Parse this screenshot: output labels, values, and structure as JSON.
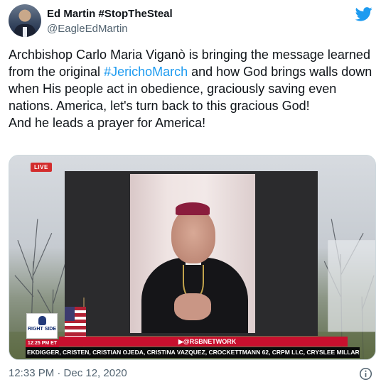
{
  "author": {
    "name": "Ed Martin #StopTheSteal",
    "handle": "@EagleEdMartin",
    "avatar_icon": "avatar-photo"
  },
  "tweet": {
    "text_before_link": "Archbishop Carlo Maria Viganò is bringing the message learned from the original ",
    "hashtag": "#JerichoMarch",
    "text_after_link": " and how God brings walls down when His people act in obedience, graciously saving even nations.  America, let's turn back to this gracious God!",
    "text_line_last": "And he leads a prayer for America!"
  },
  "media": {
    "live_label": "LIVE",
    "logo_text": "RIGHT SIDE",
    "time_label": "12:25 PM ET",
    "network_label": "▶@RSBNETWORK",
    "ticker_text": "EKDIGGER, CRISTEN, CRISTIAN OJEDA, CRISTINA VAZQUEZ, CROCKETTMANN 62, CRPM LLC, CRYSLEE MILLAR, CRYSTAL"
  },
  "footer": {
    "timestamp": "12:33 PM · Dec 12, 2020",
    "info_icon": "info-icon"
  },
  "colors": {
    "link": "#1d9bf0",
    "twitter_blue": "#1d9bf0",
    "muted": "#536471",
    "text": "#0f1419",
    "rsb_red": "#c8102e"
  }
}
